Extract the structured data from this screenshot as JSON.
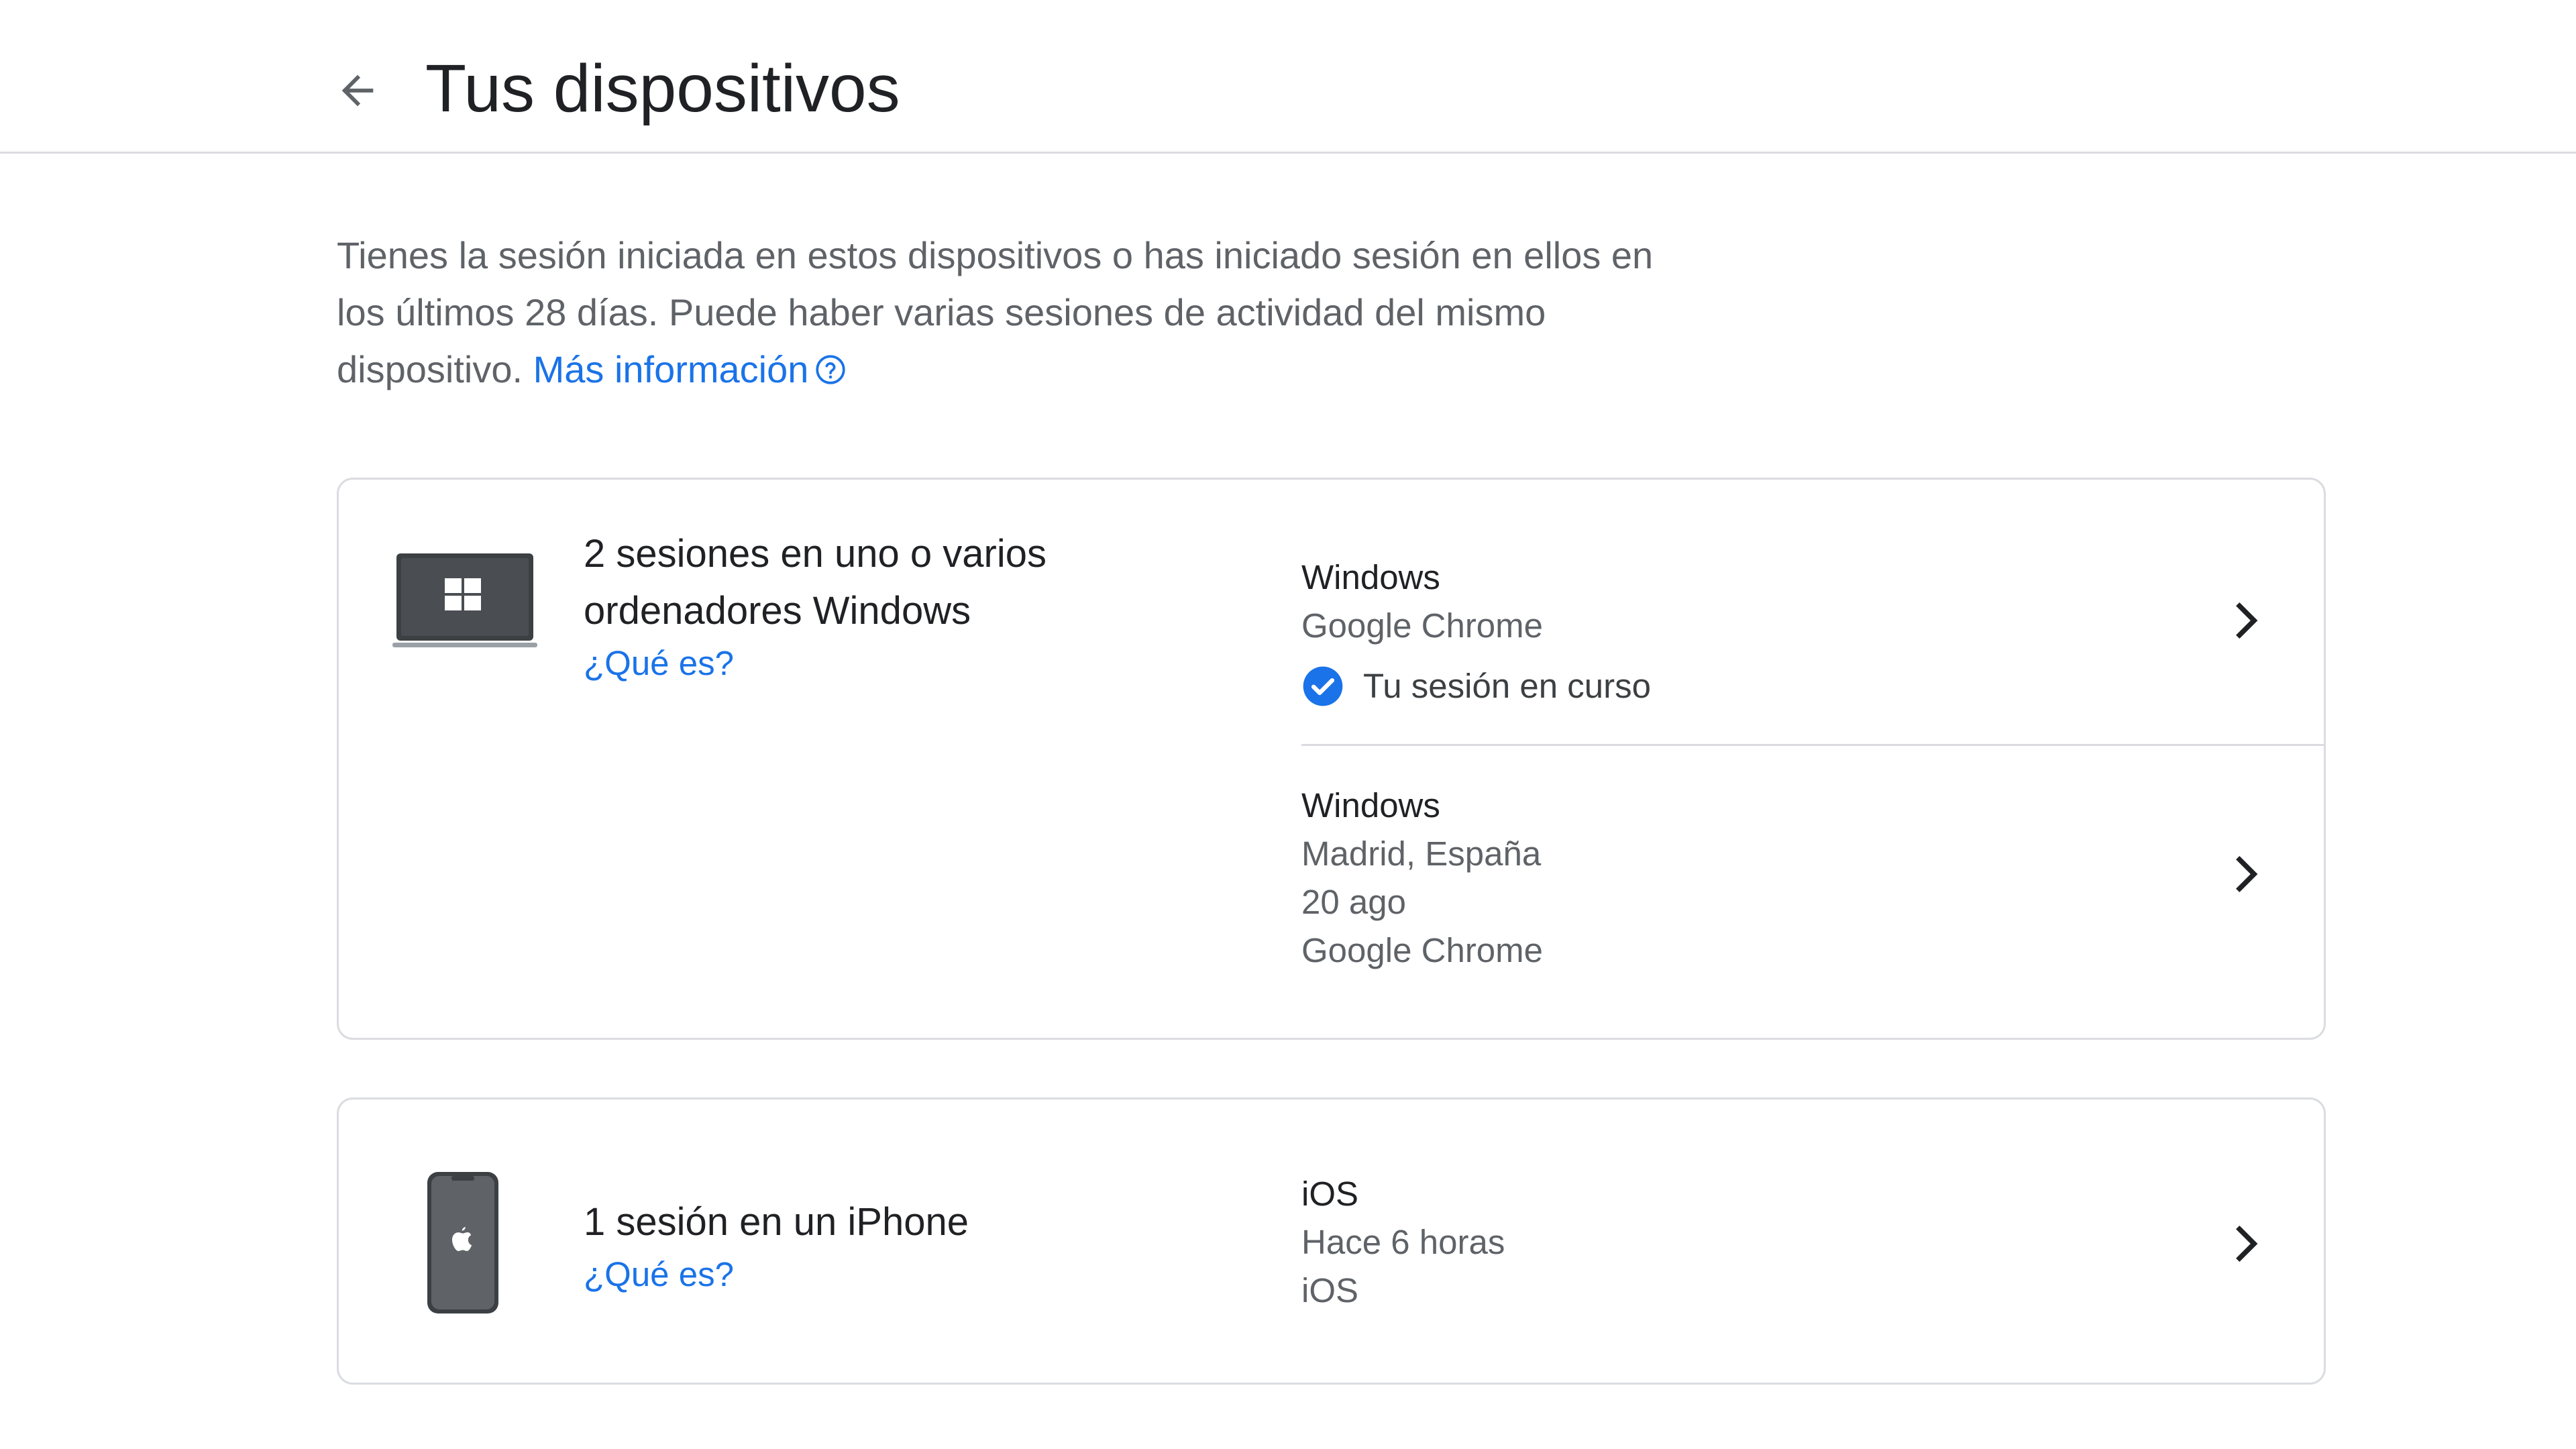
{
  "header": {
    "title": "Tus dispositivos",
    "back_icon": "arrow-back-icon"
  },
  "intro": {
    "text": "Tienes la sesión iniciada en estos dispositivos o has iniciado sesión en ellos en los últimos 28 días. Puede haber varias sesiones de actividad del mismo dispositivo.",
    "link_label": "Más información",
    "link_icon": "help-circle-icon"
  },
  "colors": {
    "link": "#1a73e8",
    "check": "#1a73e8",
    "device": "#3c4043"
  },
  "devices": [
    {
      "icon": "windows-laptop-icon",
      "summary_line1": "2 sesiones en uno o varios",
      "summary_line2": "ordenadores Windows",
      "what_link": "¿Qué es?",
      "sessions": [
        {
          "title": "Windows",
          "lines": [
            "Google Chrome"
          ],
          "current_label": "Tu sesión en curso"
        },
        {
          "title": "Windows",
          "lines": [
            "Madrid, España",
            "20 ago",
            "Google Chrome"
          ]
        }
      ]
    },
    {
      "icon": "iphone-icon",
      "summary_line1": "1 sesión en un iPhone",
      "what_link": "¿Qué es?",
      "sessions": [
        {
          "title": "iOS",
          "lines": [
            "Hace 6 horas",
            "iOS"
          ]
        }
      ]
    }
  ]
}
